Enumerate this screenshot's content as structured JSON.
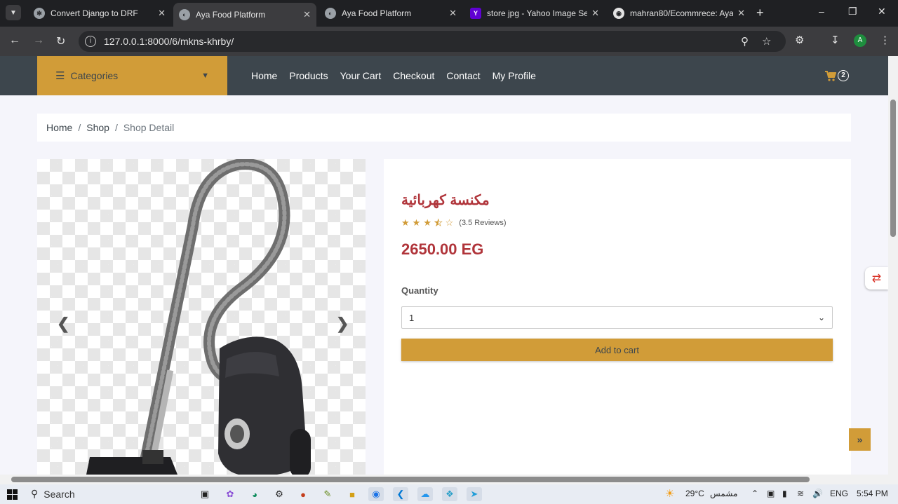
{
  "browser": {
    "tabs": [
      {
        "title": "Convert Django to DRF",
        "icon": "chatgpt-icon",
        "active": false
      },
      {
        "title": "Aya Food Platform",
        "icon": "globe-icon",
        "active": true
      },
      {
        "title": "Aya Food Platform",
        "icon": "globe-icon",
        "active": false
      },
      {
        "title": "store jpg - Yahoo Image Sea",
        "icon": "yahoo-icon",
        "active": false
      },
      {
        "title": "mahran80/Ecommrece: Aya",
        "icon": "github-icon",
        "active": false
      }
    ],
    "url": "127.0.0.1:8000/6/mkns-khrby/",
    "profile_initial": "A"
  },
  "site": {
    "categories_label": "Categories",
    "nav": [
      "Home",
      "Products",
      "Your Cart",
      "Checkout",
      "Contact",
      "My Profile"
    ],
    "cart_count": "2",
    "accent": "#d19c38",
    "nav_bg": "#3d464d"
  },
  "breadcrumb": [
    "Home",
    "Shop",
    "Shop Detail"
  ],
  "product": {
    "name": "مكنسة كهربائية",
    "rating": 3.5,
    "reviews_text": "(3.5 Reviews)",
    "price": "2650.00 EG",
    "quantity_label": "Quantity",
    "quantity_value": "1",
    "add_to_cart": "Add to cart",
    "price_color": "#b0343a"
  },
  "taskbar": {
    "search_placeholder": "Search",
    "weather_temp": "29°C",
    "weather_text": "مشمس",
    "language": "ENG",
    "time": "5:54 PM"
  }
}
